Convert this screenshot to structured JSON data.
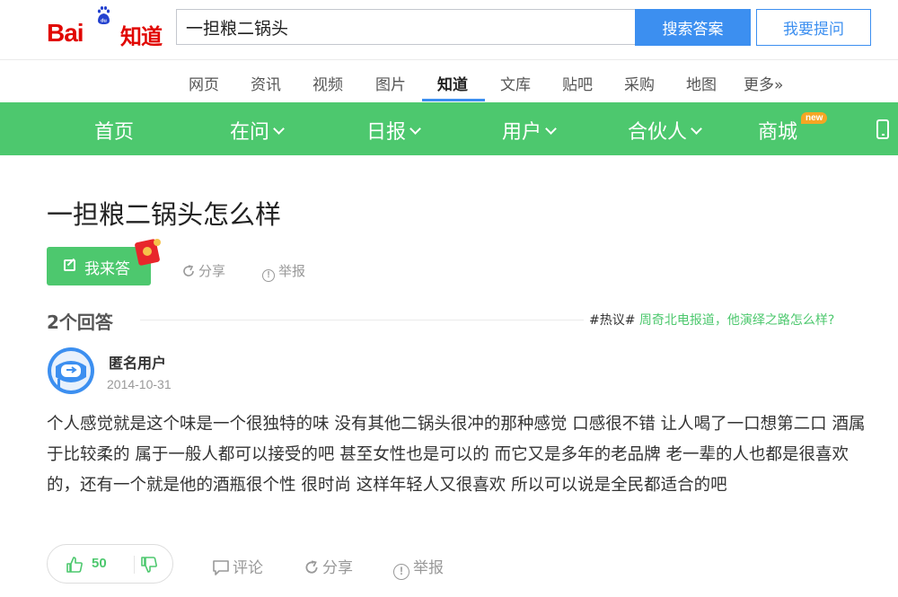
{
  "header": {
    "logo_bai": "Bai",
    "logo_du": "du",
    "logo_zhidao": "知道",
    "search_value": "一担粮二锅头",
    "search_button": "搜索答案",
    "ask_button": "我要提问"
  },
  "nav": [
    {
      "label": "网页"
    },
    {
      "label": "资讯"
    },
    {
      "label": "视频"
    },
    {
      "label": "图片"
    },
    {
      "label": "知道",
      "active": true
    },
    {
      "label": "文库"
    },
    {
      "label": "贴吧"
    },
    {
      "label": "采购"
    },
    {
      "label": "地图"
    },
    {
      "label": "更多»"
    }
  ],
  "greenbar": {
    "home": "首页",
    "zaiwen": "在问",
    "ribao": "日报",
    "yonghu": "用户",
    "huoban": "合伙人",
    "shangcheng": "商城",
    "new_badge": "new"
  },
  "question": {
    "title": "一担粮二锅头怎么样",
    "answer_button": "我来答",
    "share": "分享",
    "report": "举报"
  },
  "answers_header": {
    "count": "2个回答",
    "hot_tag": "#热议#",
    "hot_topic": " 周奇北电报道，他演绎之路怎么样?"
  },
  "answer": {
    "user": "匿名用户",
    "date": "2014-10-31",
    "text": "个人感觉就是这个味是一个很独特的味 没有其他二锅头很冲的那种感觉 口感很不错 让人喝了一口想第二口 酒属于比较柔的 属于一般人都可以接受的吧 甚至女性也是可以的 而它又是多年的老品牌 老一辈的人也都是很喜欢的，还有一个就是他的酒瓶很个性 很时尚 这样年轻人又很喜欢 所以可以说是全民都适合的吧",
    "likes": "50",
    "comment": "评论",
    "share": "分享",
    "report": "举报"
  },
  "colors": {
    "brand_red": "#e10601",
    "accent_blue": "#3c8ff0",
    "green": "#4dc86e"
  }
}
